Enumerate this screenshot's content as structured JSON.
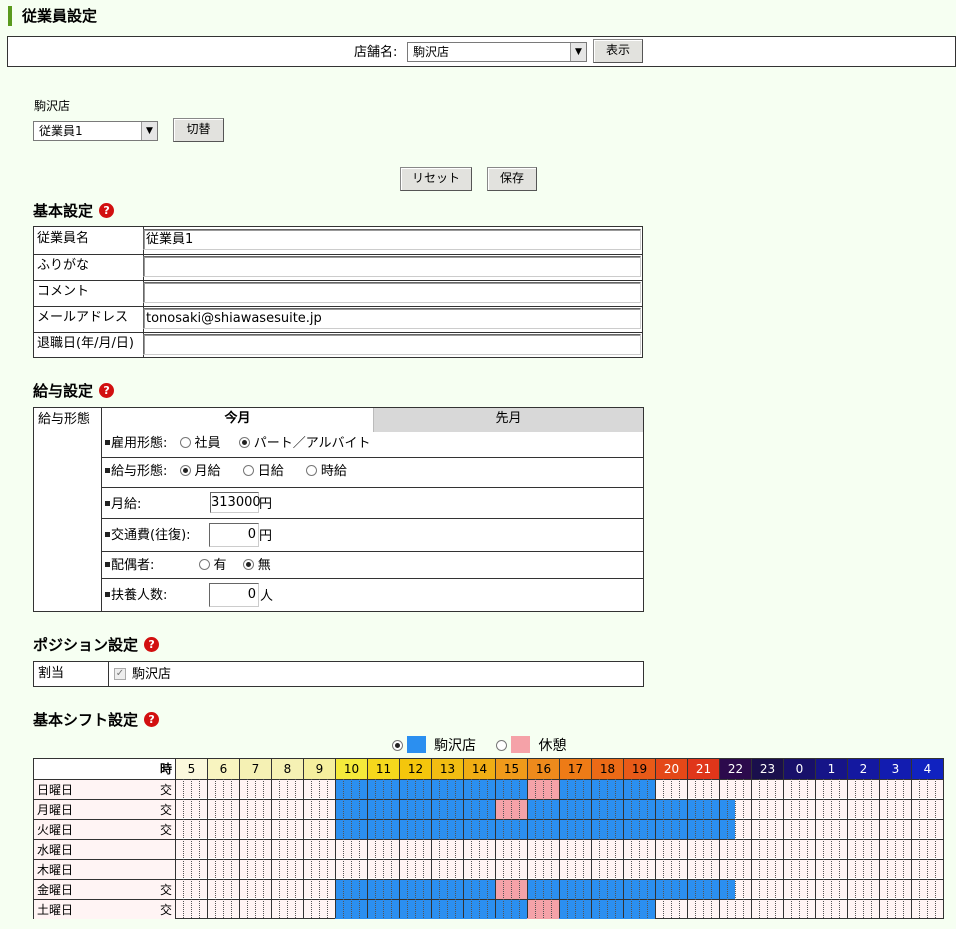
{
  "page": {
    "title": "従業員設定"
  },
  "store_bar": {
    "label": "店舗名:",
    "selected_store": "駒沢店",
    "show_button": "表示"
  },
  "employee_select": {
    "store_name": "駒沢店",
    "selected_employee": "従業員1",
    "switch_button": "切替"
  },
  "actions": {
    "reset": "リセット",
    "save": "保存"
  },
  "basic": {
    "title": "基本設定",
    "fields": [
      {
        "label": "従業員名",
        "value": "従業員1"
      },
      {
        "label": "ふりがな",
        "value": ""
      },
      {
        "label": "コメント",
        "value": ""
      },
      {
        "label": "メールアドレス",
        "value": "tonosaki@shiawasesuite.jp"
      },
      {
        "label": "退職日(年/月/日)",
        "value": ""
      }
    ]
  },
  "salary": {
    "title": "給与設定",
    "row_label": "給与形態",
    "tabs": {
      "current": "今月",
      "previous": "先月"
    },
    "employment_type": {
      "label": "雇用形態:",
      "options": [
        "社員",
        "パート／アルバイト"
      ],
      "selected": "パート／アルバイト"
    },
    "pay_type": {
      "label": "給与形態:",
      "options": [
        "月給",
        "日給",
        "時給"
      ],
      "selected": "月給"
    },
    "monthly": {
      "label": "月給:",
      "value": "313000",
      "unit": "円"
    },
    "transport": {
      "label": "交通費(往復):",
      "value": "0",
      "unit": "円"
    },
    "spouse": {
      "label": "配偶者:",
      "options": [
        "有",
        "無"
      ],
      "selected": "無"
    },
    "dependents": {
      "label": "扶養人数:",
      "value": "0",
      "unit": "人"
    }
  },
  "position": {
    "title": "ポジション設定",
    "label": "割当",
    "checkbox_label": "駒沢店",
    "checked": true
  },
  "shift": {
    "title": "基本シフト設定",
    "legend": [
      {
        "label": "駒沢店",
        "color": "#2b8ff0",
        "selected": true
      },
      {
        "label": "休憩",
        "color": "#f5a2a8",
        "selected": false
      }
    ],
    "hour_header_label": "時",
    "hours": [
      "5",
      "6",
      "7",
      "8",
      "9",
      "10",
      "11",
      "12",
      "13",
      "14",
      "15",
      "16",
      "17",
      "18",
      "19",
      "20",
      "21",
      "22",
      "23",
      "0",
      "1",
      "2",
      "3",
      "4"
    ],
    "hour_colors": [
      "#fbf8dc",
      "#f8f4c0",
      "#f5f1b4",
      "#f5f1b4",
      "#f5ef9e",
      "#f5ea3a",
      "#f5d81c",
      "#f4c60c",
      "#f2bd12",
      "#f0ad14",
      "#f09a1a",
      "#ee8a1c",
      "#ee7b16",
      "#ec6a16",
      "#e85a18",
      "#e44818",
      "#e0361a",
      "#2c0a4c",
      "#1a0f4c",
      "#18106a",
      "#161488",
      "#1418a0",
      "#121cb0",
      "#1022c0"
    ],
    "hour_text_colors": [
      "#000",
      "#000",
      "#000",
      "#000",
      "#000",
      "#000",
      "#000",
      "#000",
      "#000",
      "#000",
      "#000",
      "#000",
      "#000",
      "#000",
      "#000",
      "#fff",
      "#fff",
      "#fff",
      "#fff",
      "#fff",
      "#fff",
      "#fff",
      "#fff",
      "#fff"
    ],
    "days": [
      {
        "name": "日曜日",
        "mark": "交",
        "blue": [
          [
            10,
            16
          ],
          [
            17,
            20
          ]
        ],
        "pink": [
          [
            16,
            17
          ]
        ]
      },
      {
        "name": "月曜日",
        "mark": "交",
        "blue": [
          [
            10,
            15
          ],
          [
            16,
            22.5
          ]
        ],
        "pink": [
          [
            15,
            16
          ]
        ]
      },
      {
        "name": "火曜日",
        "mark": "交",
        "blue": [
          [
            10,
            22.5
          ]
        ],
        "pink": []
      },
      {
        "name": "水曜日",
        "mark": "",
        "blue": [],
        "pink": []
      },
      {
        "name": "木曜日",
        "mark": "",
        "blue": [],
        "pink": []
      },
      {
        "name": "金曜日",
        "mark": "交",
        "blue": [
          [
            10,
            15
          ],
          [
            16,
            22.5
          ]
        ],
        "pink": [
          [
            15,
            16
          ]
        ]
      },
      {
        "name": "土曜日",
        "mark": "交",
        "blue": [
          [
            10,
            16
          ],
          [
            17,
            20
          ]
        ],
        "pink": [
          [
            16,
            17
          ]
        ]
      }
    ]
  }
}
